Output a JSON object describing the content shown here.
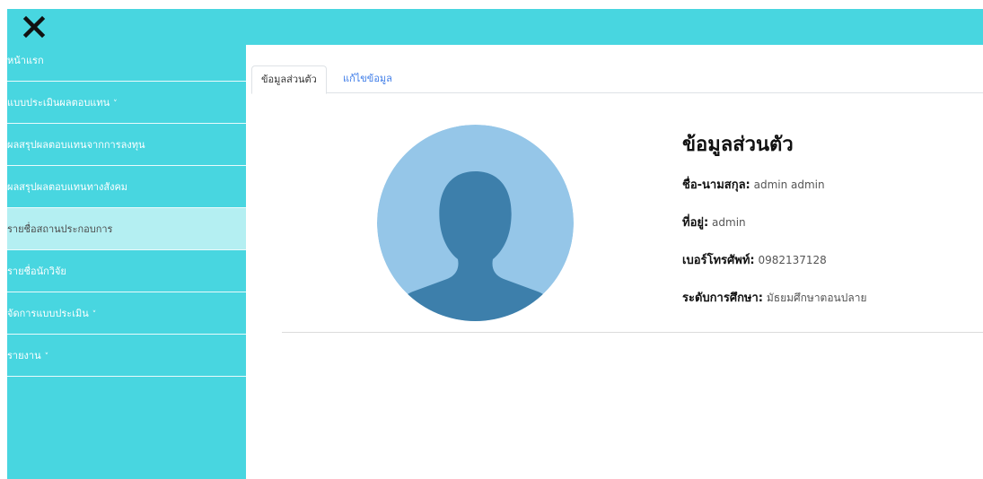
{
  "colors": {
    "accent": "#48d6e0",
    "active_item": "#b4eff2",
    "link": "#3d7ce8",
    "avatar_bg": "#95c6e8",
    "avatar_fg": "#3d7fab"
  },
  "header": {
    "close_icon": "close-icon"
  },
  "sidebar": {
    "items": [
      {
        "label": "หน้าแรก",
        "dropdown": false
      },
      {
        "label": "แบบประเมินผลตอบแทน",
        "dropdown": true
      },
      {
        "label": "ผลสรุปผลตอบแทนจากการลงทุน",
        "dropdown": false
      },
      {
        "label": "ผลสรุปผลตอบแทนทางสังคม",
        "dropdown": false
      },
      {
        "label": "รายชื่อสถานประกอบการ",
        "dropdown": false,
        "active": true
      },
      {
        "label": "รายชื่อนักวิจัย",
        "dropdown": false
      },
      {
        "label": "จัดการแบบประเมิน",
        "dropdown": true
      },
      {
        "label": "รายงาน",
        "dropdown": true
      }
    ],
    "chevron": "˅"
  },
  "tabs": {
    "profile": "ข้อมูลส่วนตัว",
    "edit": "แก้ไขข้อมูล"
  },
  "profile": {
    "title": "ข้อมูลส่วนตัว",
    "name_label": "ชื่อ-นามสกุล:",
    "name_value": "admin admin",
    "address_label": "ที่อยู่:",
    "address_value": "admin",
    "phone_label": "เบอร์โทรศัพท์:",
    "phone_value": "0982137128",
    "education_label": "ระดับการศึกษา:",
    "education_value": "มัธยมศึกษาตอนปลาย"
  }
}
